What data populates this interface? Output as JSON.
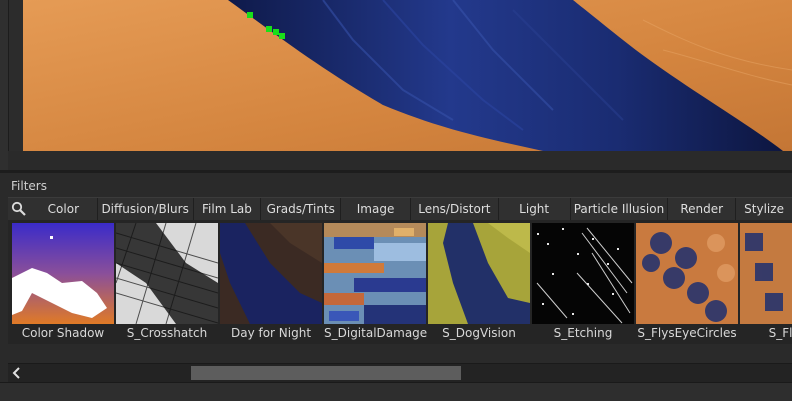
{
  "filters": {
    "title": "Filters",
    "tabs": [
      "Color",
      "Diffusion/Blurs",
      "Film Lab",
      "Grads/Tints",
      "Image",
      "Lens/Distort",
      "Light",
      "Particle Illusion",
      "Render",
      "Stylize"
    ],
    "thumbnails": [
      "Color Shadow",
      "S_Crosshatch",
      "Day for Night",
      "S_DigitalDamage",
      "S_DogVision",
      "S_Etching",
      "S_FlysEyeCircles",
      "S_FlysE"
    ]
  },
  "colors": {
    "sand": "#d88a49",
    "cloth": "#1c2f7a",
    "panel": "#2a2a2a",
    "marker": "#19e019"
  },
  "icons": [
    "search-icon",
    "chevron-left-icon"
  ]
}
